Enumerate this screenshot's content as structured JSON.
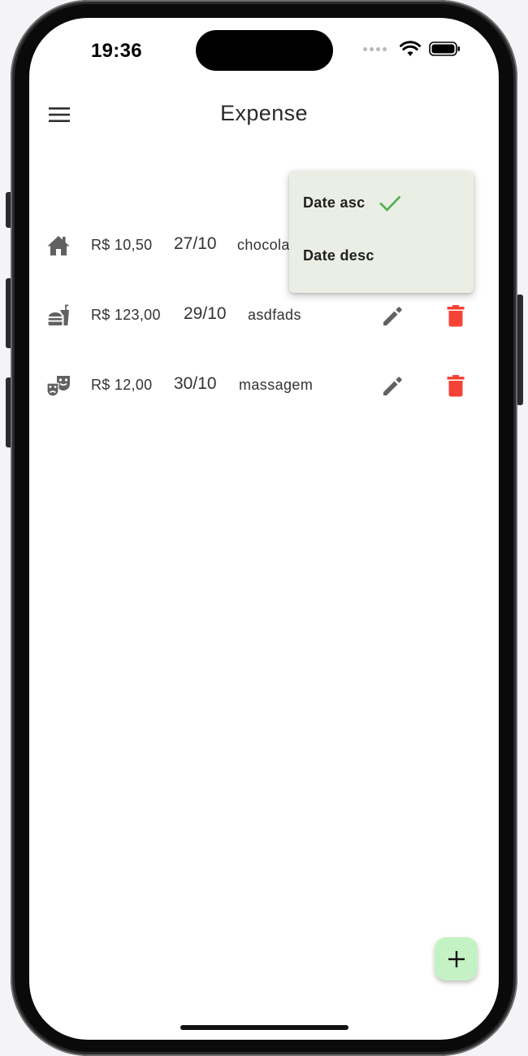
{
  "status_bar": {
    "time": "19:36"
  },
  "app_bar": {
    "title": "Expense",
    "menu_icon": "menu-icon"
  },
  "expenses": [
    {
      "category_icon": "house-icon",
      "amount": "R$ 10,50",
      "date": "27/10",
      "description": "chocola"
    },
    {
      "category_icon": "fastfood-icon",
      "amount": "R$ 123,00",
      "date": "29/10",
      "description": "asdfads"
    },
    {
      "category_icon": "theater-masks-icon",
      "amount": "R$ 12,00",
      "date": "30/10",
      "description": "massagem"
    }
  ],
  "sort_menu": {
    "items": [
      {
        "label": "Date asc",
        "selected": true
      },
      {
        "label": "Date desc",
        "selected": false
      }
    ],
    "check_color": "#4caf50",
    "background": "#eaeee4"
  },
  "colors": {
    "delete": "#f44336",
    "icon": "#616161",
    "fab": "#c5f2c5"
  },
  "fab": {
    "icon": "plus-icon"
  }
}
